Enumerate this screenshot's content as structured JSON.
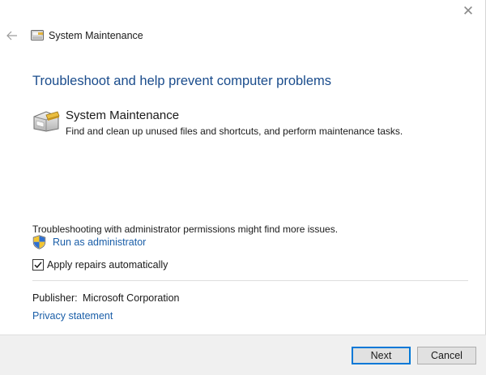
{
  "window": {
    "title": "System Maintenance",
    "close_symbol": "✕",
    "back_icon": "back-arrow-icon"
  },
  "content": {
    "heading": "Troubleshoot and help prevent computer problems",
    "item": {
      "icon": "system-maintenance-icon",
      "title": "System Maintenance",
      "description": "Find and clean up unused files and shortcuts, and perform maintenance tasks."
    },
    "admin_note": "Troubleshooting with administrator permissions might find more issues.",
    "run_as_admin": {
      "icon": "uac-shield-icon",
      "label": "Run as administrator"
    },
    "apply_repairs": {
      "label": "Apply repairs automatically",
      "checked": true
    },
    "publisher": {
      "label": "Publisher:",
      "value": "Microsoft Corporation"
    },
    "privacy_link": "Privacy statement"
  },
  "footer": {
    "next_label": "Next",
    "cancel_label": "Cancel"
  },
  "colors": {
    "heading": "#1a4c8c",
    "link": "#1a5ea8",
    "default_button_border": "#0078d7",
    "footer_background": "#f0f0f0"
  }
}
